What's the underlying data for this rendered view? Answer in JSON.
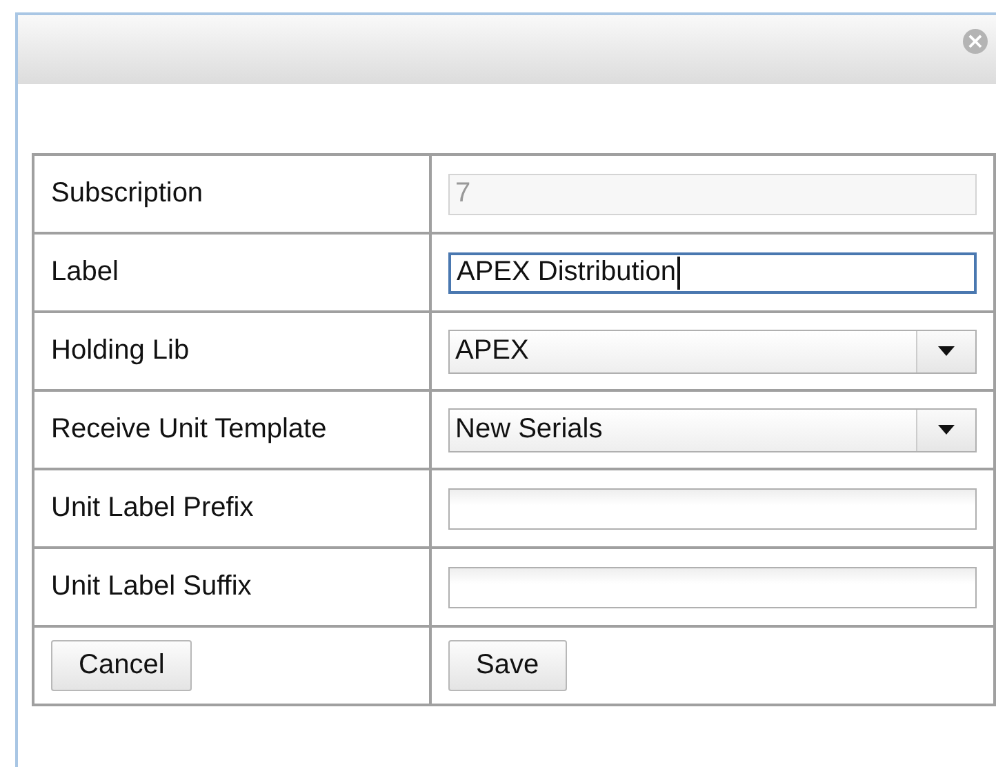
{
  "dialog": {
    "close_button": "×"
  },
  "fields": [
    {
      "label": "Subscription",
      "kind": "text",
      "value": "7",
      "disabled": true,
      "focused": false
    },
    {
      "label": "Label",
      "kind": "text",
      "value": "APEX Distribution",
      "disabled": false,
      "focused": true
    },
    {
      "label": "Holding Lib",
      "kind": "select",
      "value": "APEX",
      "disabled": false,
      "focused": false
    },
    {
      "label": "Receive Unit Template",
      "kind": "select",
      "value": "New Serials",
      "disabled": false,
      "focused": false
    },
    {
      "label": "Unit Label Prefix",
      "kind": "text",
      "disabled": false,
      "focused": false
    },
    {
      "label": "Unit Label Suffix",
      "kind": "text",
      "disabled": false,
      "focused": false
    }
  ],
  "buttons": [
    "Cancel",
    "Save"
  ]
}
